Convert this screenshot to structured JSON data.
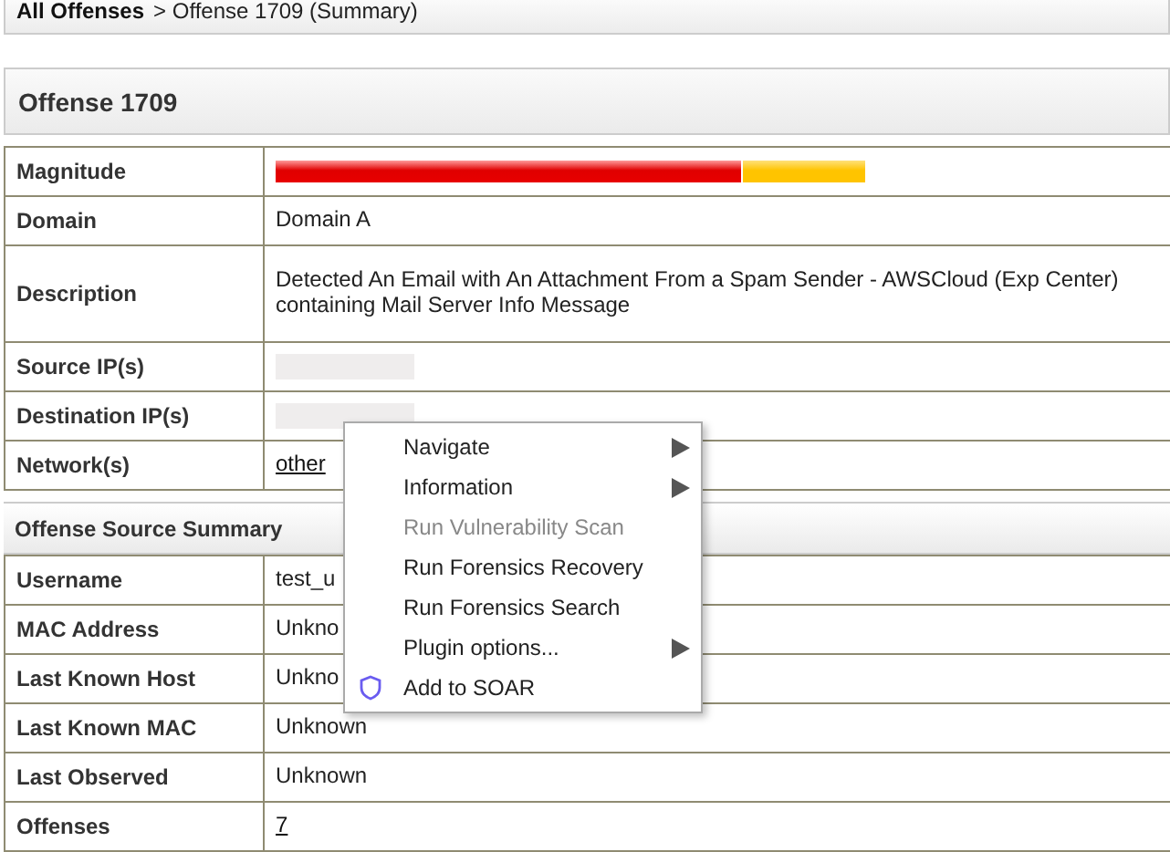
{
  "breadcrumb": {
    "root": "All Offenses",
    "current": "> Offense 1709 (Summary)"
  },
  "offense": {
    "title": "Offense 1709",
    "rows": [
      {
        "label": "Magnitude",
        "kind": "magnitude",
        "level": 0.79
      },
      {
        "label": "Domain",
        "kind": "text",
        "value": "Domain A"
      },
      {
        "label": "Description",
        "kind": "text",
        "value": "Detected An Email with An Attachment From a Spam Sender - AWSCloud (Exp Center) containing Mail Server Info Message"
      },
      {
        "label": "Source IP(s)",
        "kind": "redacted"
      },
      {
        "label": "Destination IP(s)",
        "kind": "redacted"
      },
      {
        "label": "Network(s)",
        "kind": "link",
        "value": "other"
      }
    ]
  },
  "source_summary": {
    "title": "Offense Source Summary",
    "rows": [
      {
        "label": "Username",
        "kind": "text",
        "value": "test_u"
      },
      {
        "label": "MAC Address",
        "kind": "text",
        "value": "Unkno"
      },
      {
        "label": "Last Known Host",
        "kind": "text",
        "value": "Unkno"
      },
      {
        "label": "Last Known MAC",
        "kind": "text",
        "value": "Unknown"
      },
      {
        "label": "Last Observed",
        "kind": "text",
        "value": "Unknown"
      },
      {
        "label": "Offenses",
        "kind": "link",
        "value": "7"
      }
    ]
  },
  "context_menu": [
    {
      "label": "Navigate",
      "disabled": false,
      "submenu": true
    },
    {
      "label": "Information",
      "disabled": false,
      "submenu": true
    },
    {
      "label": "Run Vulnerability Scan",
      "disabled": true,
      "submenu": false
    },
    {
      "label": "Run Forensics Recovery",
      "disabled": false,
      "submenu": false
    },
    {
      "label": "Run Forensics Search",
      "disabled": false,
      "submenu": false
    },
    {
      "label": "Plugin options...",
      "disabled": false,
      "submenu": true
    },
    {
      "label": "Add to SOAR",
      "disabled": false,
      "submenu": false,
      "kind": "with_icon"
    }
  ]
}
